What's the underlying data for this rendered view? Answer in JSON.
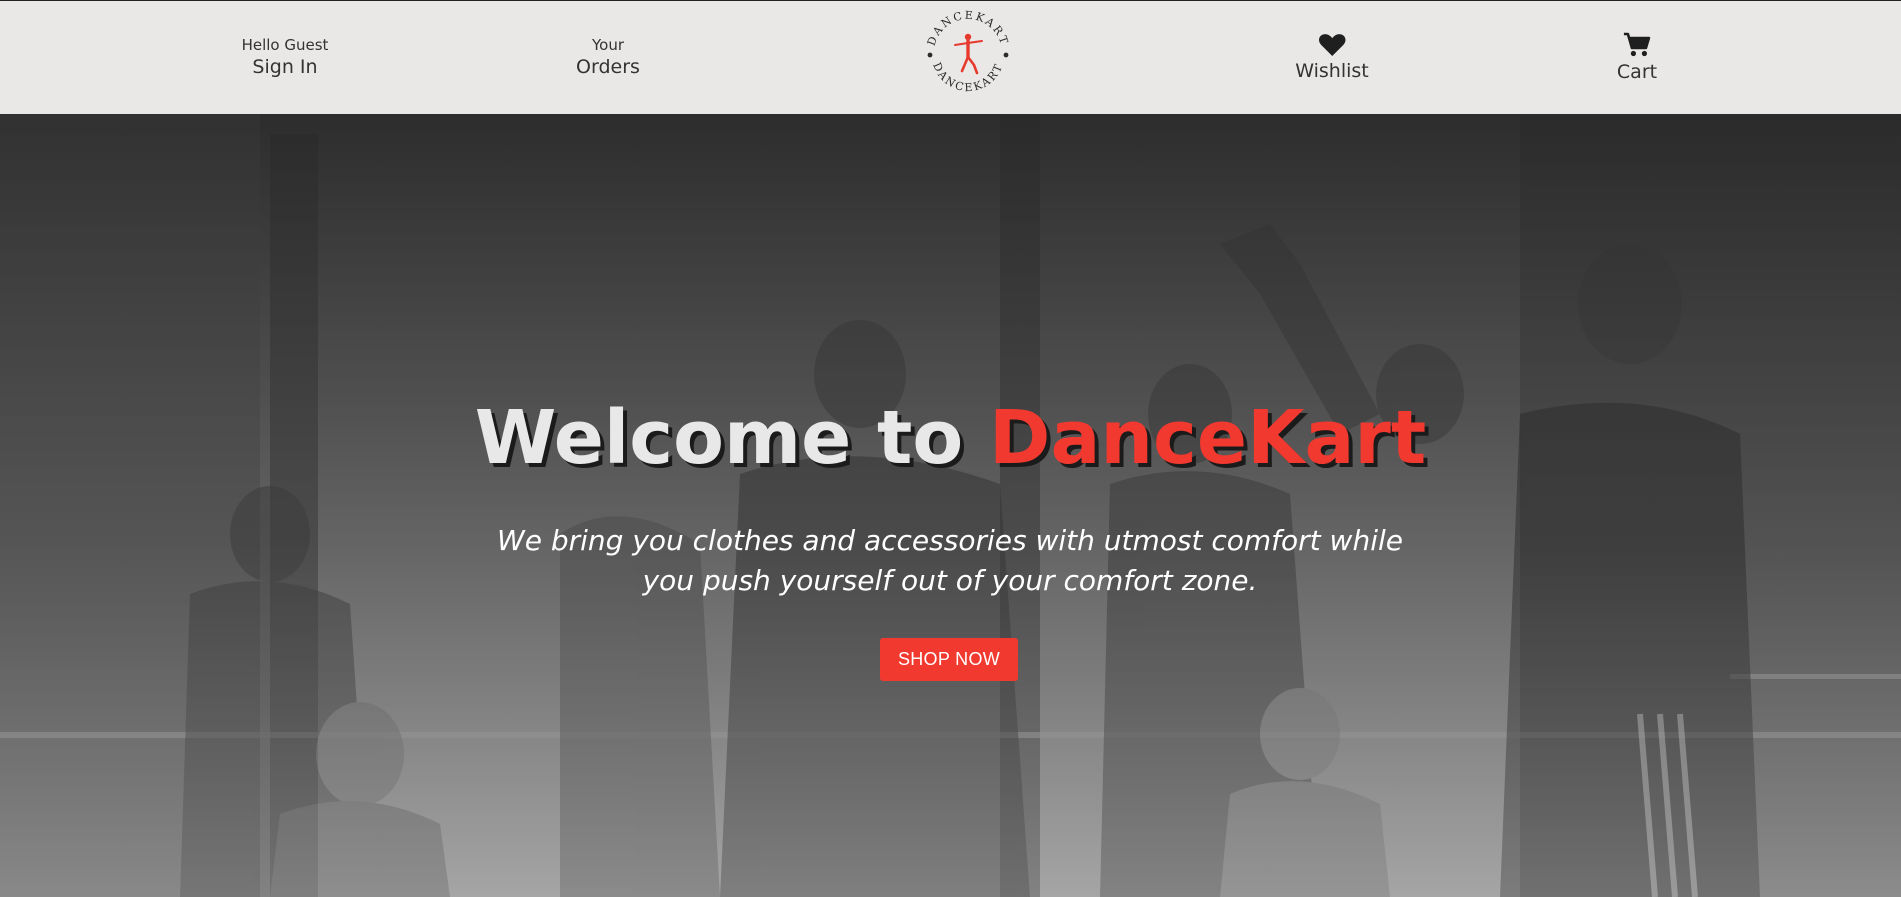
{
  "header": {
    "signin": {
      "greeting": "Hello Guest",
      "label": "Sign In"
    },
    "orders": {
      "top": "Your",
      "label": "Orders"
    },
    "logo": {
      "text_top": "DANCEKART",
      "text_bottom": "DANCEKART",
      "color": "#f1392f"
    },
    "wishlist": {
      "label": "Wishlist",
      "icon": "heart-icon"
    },
    "cart": {
      "label": "Cart",
      "icon": "cart-icon"
    }
  },
  "hero": {
    "title_prefix": "Welcome to ",
    "title_brand": "DanceKart",
    "subtitle": "We bring you clothes and accessories with utmost comfort while you push yourself out of your comfort zone.",
    "cta_label": "SHOP NOW"
  },
  "colors": {
    "accent": "#f1392f",
    "header_bg": "#e9e8e6"
  }
}
